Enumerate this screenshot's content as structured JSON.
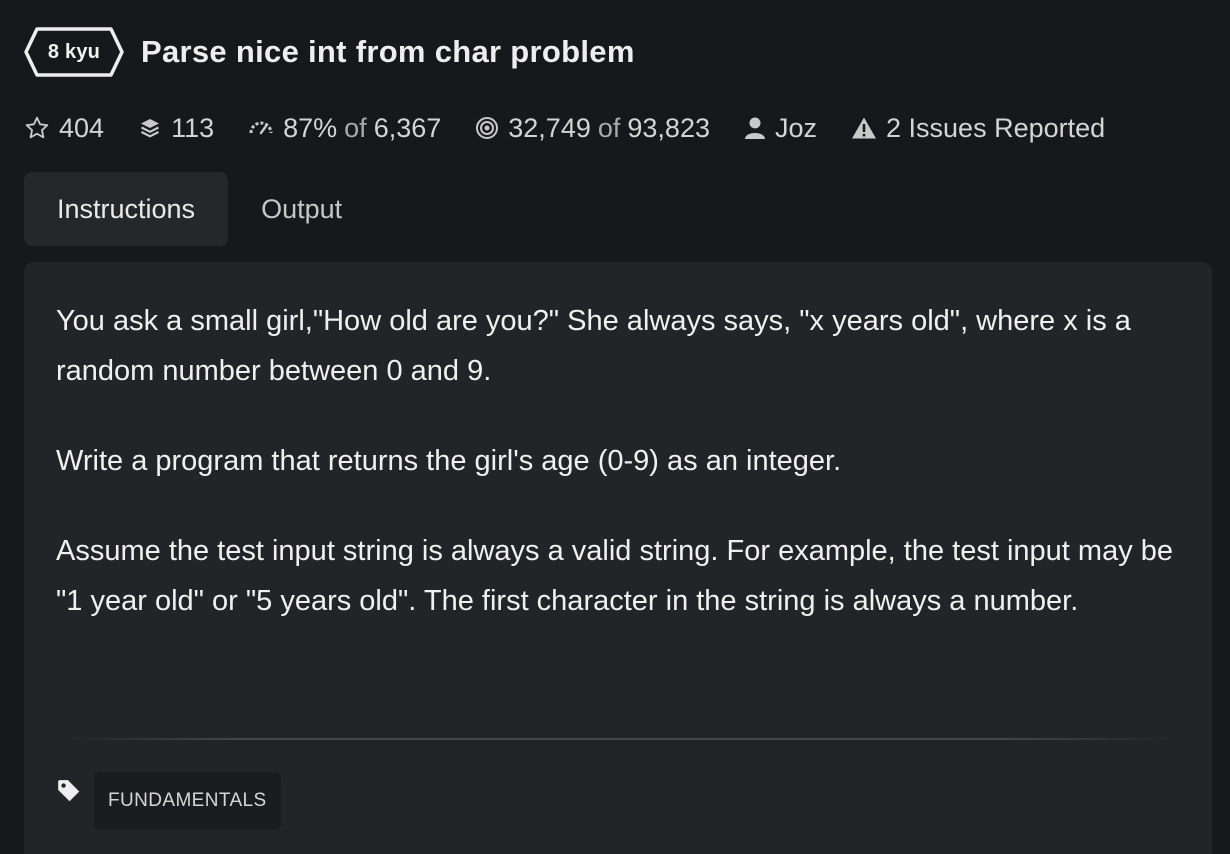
{
  "header": {
    "rank": "8 kyu",
    "title": "Parse nice int from char problem"
  },
  "stats": {
    "stars": "404",
    "collections": "113",
    "satisfaction_pct": "87%",
    "satisfaction_of": "of",
    "satisfaction_votes": "6,367",
    "completed": "32,749",
    "completed_of": "of",
    "attempted": "93,823",
    "author": "Joz",
    "issues": "2 Issues Reported"
  },
  "tabs": [
    {
      "label": "Instructions",
      "active": true
    },
    {
      "label": "Output",
      "active": false
    }
  ],
  "description": {
    "paragraphs": [
      "You ask a small girl,\"How old are you?\" She always says, \"x years old\", where x is a random number between 0 and 9.",
      "Write a program that returns the girl's age (0-9) as an integer.",
      "Assume the test input string is always a valid string. For example, the test input may be \"1 year old\" or \"5 years old\". The first character in the string is always a number."
    ]
  },
  "tags": [
    "FUNDAMENTALS"
  ],
  "icons": {
    "stars": "star-icon",
    "collections": "layers-icon",
    "satisfaction": "gauge-icon",
    "completed": "target-icon",
    "author": "user-icon",
    "issues": "warning-icon",
    "tags": "tag-icon"
  },
  "colors": {
    "background": "#17181b",
    "panel": "#232428",
    "active_tab": "#26272b",
    "tag_bg": "#1b1c1f"
  }
}
